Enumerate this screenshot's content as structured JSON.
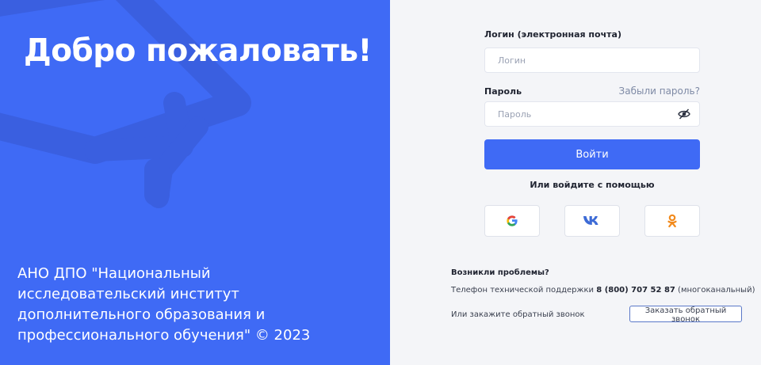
{
  "left": {
    "welcome": "Добро пожаловать!",
    "org_line1": "АНО ДПО \"Национальный",
    "org_line2": "исследовательский институт",
    "org_line3": "дополнительного образования и",
    "org_line4": "профессионального обучения\" © 2023",
    "background_color": "#3f6af5"
  },
  "form": {
    "login_label": "Логин (электронная почта)",
    "login_placeholder": "Логин",
    "password_label": "Пароль",
    "forgot_link": "Забыли пароль?",
    "password_placeholder": "Пароль",
    "password_toggle_icon": "eye-crossed-icon",
    "submit_label": "Войти",
    "or_text": "Или войдите с помощью",
    "social": [
      {
        "name": "google",
        "icon": "google-icon"
      },
      {
        "name": "vk",
        "icon": "vk-icon"
      },
      {
        "name": "odnoklassniki",
        "icon": "odnoklassniki-icon"
      }
    ],
    "accent_color": "#3f6af5"
  },
  "help": {
    "title": "Возникли проблемы?",
    "phone_prefix": "Телефон технической поддержки",
    "phone_number": "8 (800) 707 52 87",
    "phone_suffix": "(многоканальный)",
    "callback_text": "Или закажите обратный звонок",
    "callback_button": "Заказать обратный звонок"
  }
}
